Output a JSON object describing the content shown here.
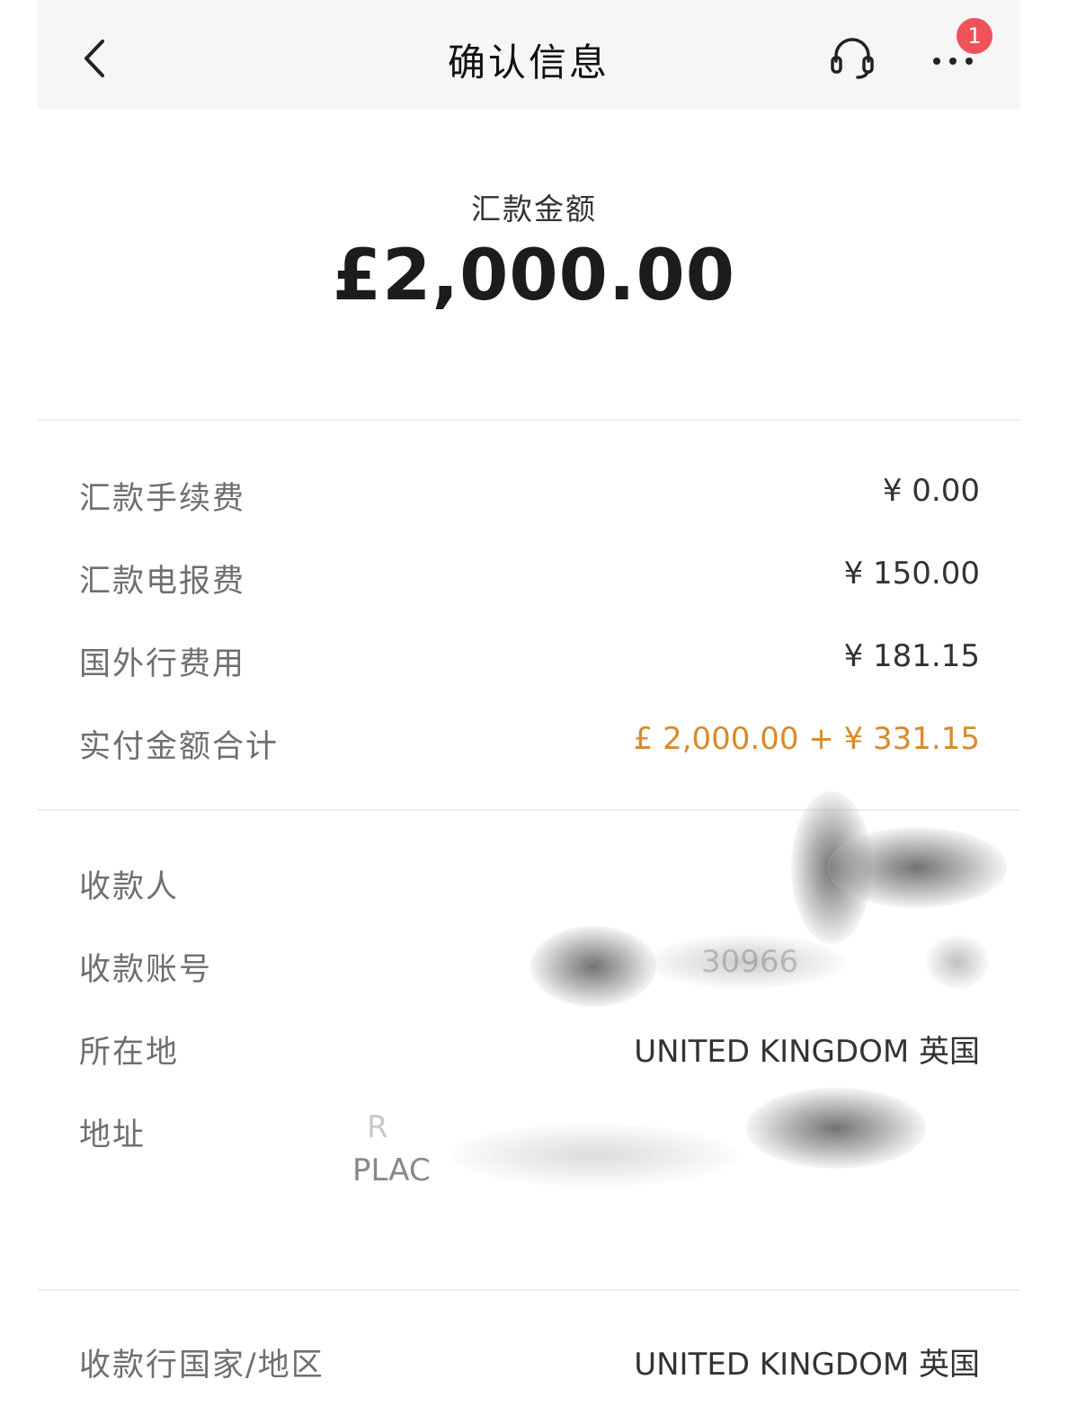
{
  "header": {
    "title": "确认信息",
    "notification_count": "1",
    "icons": [
      "back-chevron-icon",
      "headset-support-icon",
      "more-dots-icon"
    ]
  },
  "summary": {
    "label": "汇款金额",
    "amount": "£2,000.00"
  },
  "fees": [
    {
      "label": "汇款手续费",
      "value": "¥ 0.00"
    },
    {
      "label": "汇款电报费",
      "value": "¥ 150.00"
    },
    {
      "label": "国外行费用",
      "value": "¥ 181.15"
    },
    {
      "label": "实付金额合计",
      "value": "£ 2,000.00 + ¥ 331.15"
    }
  ],
  "payee": {
    "name_label": "收款人",
    "account_label": "收款账号",
    "account_partial": "30966",
    "location_label": "所在地",
    "location_value": "UNITED KINGDOM 英国",
    "address_label": "地址",
    "address_partial_1": "R",
    "address_partial_2": "PLAC"
  },
  "bank": {
    "country_label": "收款行国家/地区",
    "country_value": "UNITED KINGDOM 英国"
  },
  "colors": {
    "accent_total": "#d98a2b",
    "badge": "#f0525a",
    "nav_bg": "#f6f6f6"
  }
}
